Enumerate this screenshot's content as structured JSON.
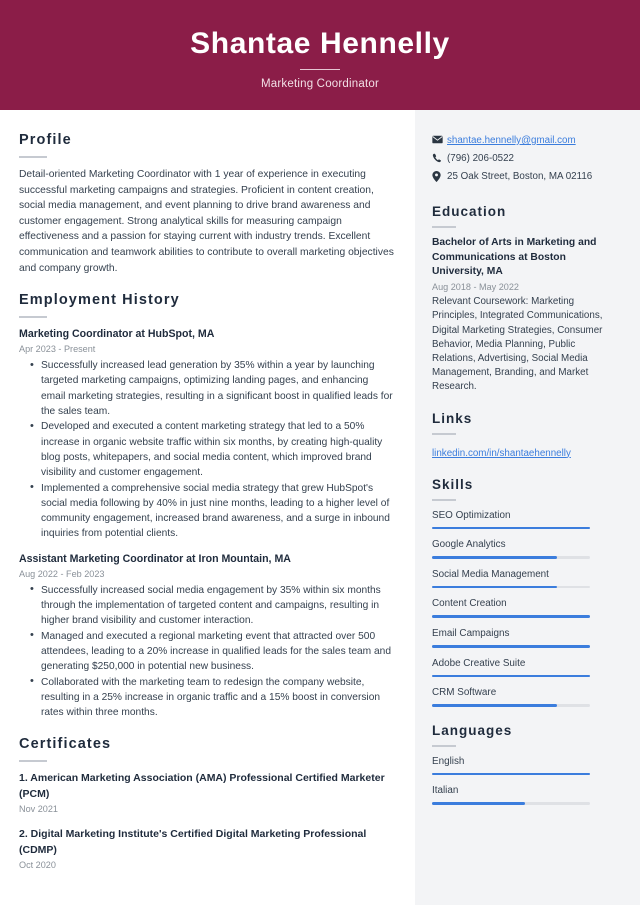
{
  "theme": {
    "header_bg": "#8b1d48",
    "sidebar_bg": "#f3f4f6",
    "accent_bar": "#3b7ddd",
    "heading_color": "#1f2b3c",
    "link_color": "#3b7ddd"
  },
  "header": {
    "name": "Shantae Hennelly",
    "job_title": "Marketing Coordinator"
  },
  "main": {
    "profile": {
      "heading": "Profile",
      "text": "Detail-oriented Marketing Coordinator with 1 year of experience in executing successful marketing campaigns and strategies. Proficient in content creation, social media management, and event planning to drive brand awareness and customer engagement. Strong analytical skills for measuring campaign effectiveness and a passion for staying current with industry trends. Excellent communication and teamwork abilities to contribute to overall marketing objectives and company growth."
    },
    "employment": {
      "heading": "Employment History",
      "jobs": [
        {
          "title": "Marketing Coordinator at HubSpot, MA",
          "date": "Apr 2023 - Present",
          "bullets": [
            "Successfully increased lead generation by 35% within a year by launching targeted marketing campaigns, optimizing landing pages, and enhancing email marketing strategies, resulting in a significant boost in qualified leads for the sales team.",
            "Developed and executed a content marketing strategy that led to a 50% increase in organic website traffic within six months, by creating high-quality blog posts, whitepapers, and social media content, which improved brand visibility and customer engagement.",
            "Implemented a comprehensive social media strategy that grew HubSpot's social media following by 40% in just nine months, leading to a higher level of community engagement, increased brand awareness, and a surge in inbound inquiries from potential clients."
          ]
        },
        {
          "title": "Assistant Marketing Coordinator at Iron Mountain, MA",
          "date": "Aug 2022 - Feb 2023",
          "bullets": [
            "Successfully increased social media engagement by 35% within six months through the implementation of targeted content and campaigns, resulting in higher brand visibility and customer interaction.",
            "Managed and executed a regional marketing event that attracted over 500 attendees, leading to a 20% increase in qualified leads for the sales team and generating $250,000 in potential new business.",
            "Collaborated with the marketing team to redesign the company website, resulting in a 25% increase in organic traffic and a 15% boost in conversion rates within three months."
          ]
        }
      ]
    },
    "certificates": {
      "heading": "Certificates",
      "items": [
        {
          "name": "1. American Marketing Association (AMA) Professional Certified Marketer (PCM)",
          "date": "Nov 2021"
        },
        {
          "name": "2. Digital Marketing Institute's Certified Digital Marketing Professional (CDMP)",
          "date": "Oct 2020"
        }
      ]
    }
  },
  "sidebar": {
    "contact": [
      {
        "icon": "envelope-icon",
        "value": "shantae.hennelly@gmail.com",
        "is_link": true
      },
      {
        "icon": "phone-icon",
        "value": "(796) 206-0522",
        "is_link": false
      },
      {
        "icon": "location-pin-icon",
        "value": "25 Oak Street, Boston, MA 02116",
        "is_link": false
      }
    ],
    "education": {
      "heading": "Education",
      "degree": "Bachelor of Arts in Marketing and Communications at Boston University, MA",
      "date": "Aug 2018 - May 2022",
      "description": "Relevant Coursework: Marketing Principles, Integrated Communications, Digital Marketing Strategies, Consumer Behavior, Media Planning, Public Relations, Advertising, Social Media Management, Branding, and Market Research."
    },
    "links": {
      "heading": "Links",
      "items": [
        {
          "label": "linkedin.com/in/shantaehennelly"
        }
      ]
    },
    "skills": {
      "heading": "Skills",
      "items": [
        {
          "label": "SEO Optimization",
          "level": 100
        },
        {
          "label": "Google Analytics",
          "level": 79
        },
        {
          "label": "Social Media Management",
          "level": 79
        },
        {
          "label": "Content Creation",
          "level": 100
        },
        {
          "label": "Email Campaigns",
          "level": 100
        },
        {
          "label": "Adobe Creative Suite",
          "level": 100
        },
        {
          "label": "CRM Software",
          "level": 79
        }
      ]
    },
    "languages": {
      "heading": "Languages",
      "items": [
        {
          "label": "English",
          "level": 100
        },
        {
          "label": "Italian",
          "level": 59
        }
      ]
    }
  }
}
